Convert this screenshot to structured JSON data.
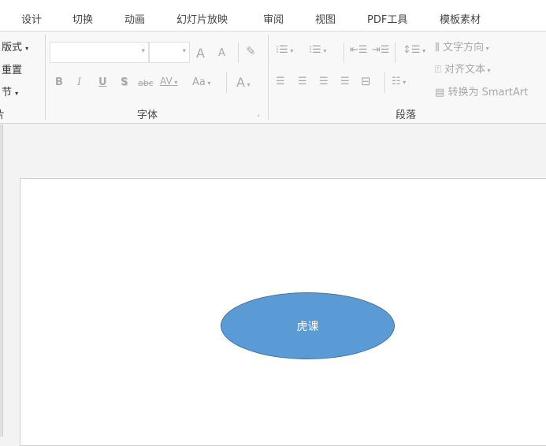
{
  "tabs": [
    "设计",
    "切换",
    "动画",
    "幻灯片放映",
    "审阅",
    "视图",
    "PDF工具",
    "模板素材"
  ],
  "slides_group": {
    "layout": "版式",
    "reset": "重置",
    "section": "节",
    "label_partial": "片"
  },
  "font_group": {
    "label": "字体",
    "bold": "B",
    "italic": "I",
    "underline": "U",
    "shadow": "S",
    "strike": "abc",
    "spacing": "AV",
    "case": "Aa",
    "color": "A",
    "grow": "A",
    "shrink": "A",
    "dropdown": "▾"
  },
  "paragraph_group": {
    "label": "段落",
    "text_direction": "文字方向",
    "align_text": "对齐文本",
    "convert_smartart": "转换为 SmartArt"
  },
  "slide": {
    "shape_text": "虎课",
    "shape_fill": "#5b9bd5"
  }
}
